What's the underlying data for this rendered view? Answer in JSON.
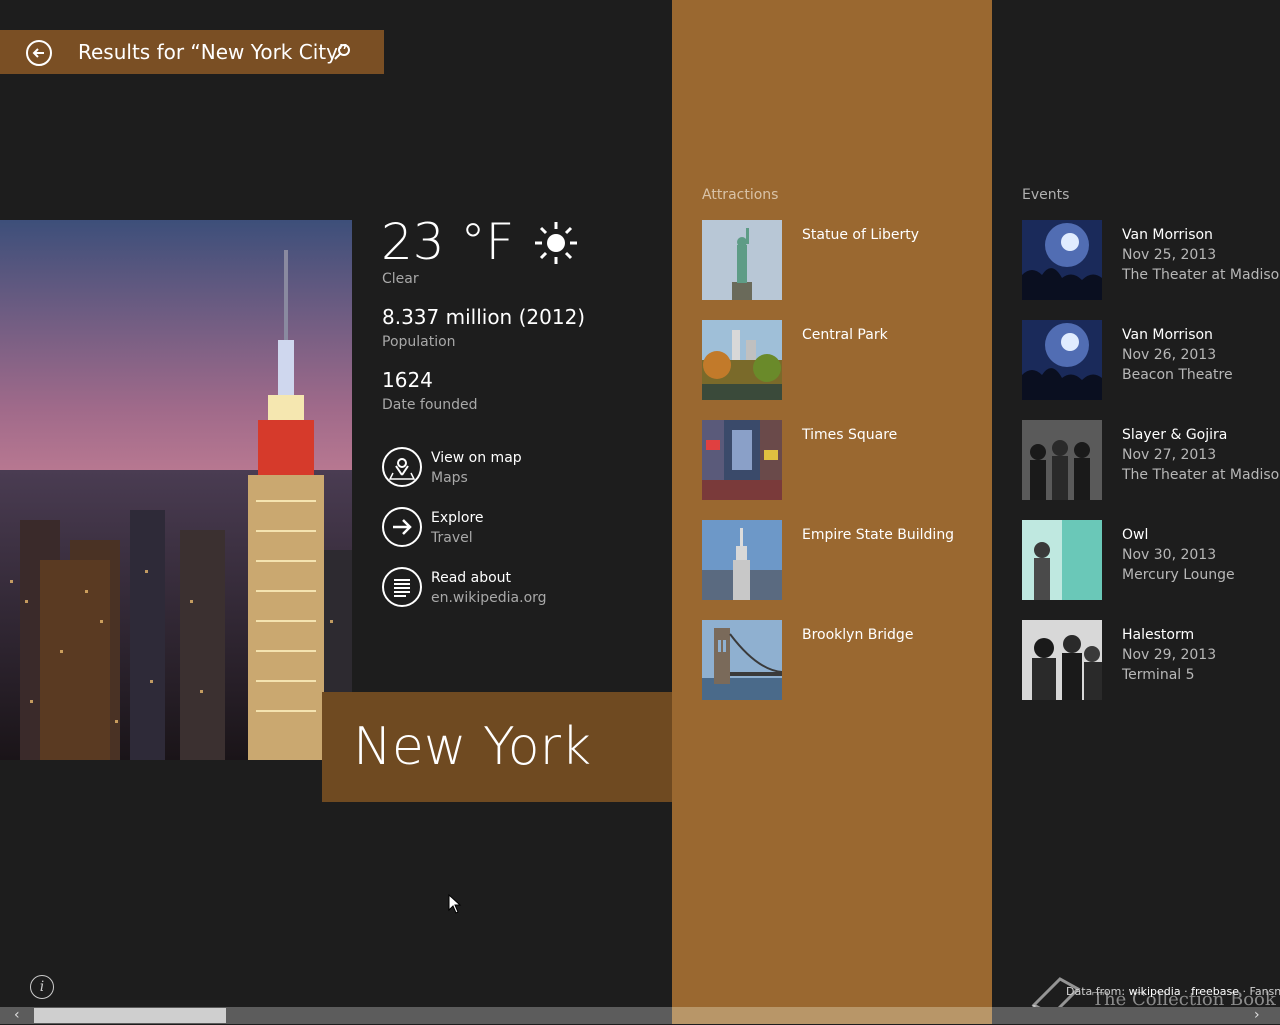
{
  "search": {
    "title": "Results for “New York City”"
  },
  "hero": {
    "city_name": "New York"
  },
  "facts": {
    "temperature": "23 °F",
    "condition": "Clear",
    "weather_icon": "sun-icon",
    "population_value": "8.337 million (2012)",
    "population_label": "Population",
    "founded_value": "1624",
    "founded_label": "Date founded"
  },
  "actions": [
    {
      "title": "View on map",
      "subtitle": "Maps",
      "icon": "map-pin-icon"
    },
    {
      "title": "Explore",
      "subtitle": "Travel",
      "icon": "arrow-right-icon"
    },
    {
      "title": "Read about",
      "subtitle": "en.wikipedia.org",
      "icon": "document-icon"
    }
  ],
  "attractions": {
    "header": "Attractions",
    "items": [
      {
        "name": "Statue of Liberty"
      },
      {
        "name": "Central Park"
      },
      {
        "name": "Times Square"
      },
      {
        "name": "Empire State Building"
      },
      {
        "name": "Brooklyn Bridge"
      }
    ]
  },
  "events": {
    "header": "Events",
    "items": [
      {
        "artist": "Van Morrison",
        "date": "Nov 25, 2013",
        "venue": "The Theater at Madison..."
      },
      {
        "artist": "Van Morrison",
        "date": "Nov 26, 2013",
        "venue": "Beacon Theatre"
      },
      {
        "artist": "Slayer & Gojira",
        "date": "Nov 27, 2013",
        "venue": "The Theater at Madison..."
      },
      {
        "artist": "Owl",
        "date": "Nov 30, 2013",
        "venue": "Mercury Lounge"
      },
      {
        "artist": "Halestorm",
        "date": "Nov 29, 2013",
        "venue": "Terminal 5"
      }
    ]
  },
  "footer": {
    "data_from": "Data from:",
    "source1": "wikipedia",
    "separator": "·",
    "source2": "freebase",
    "source3": "Fansnap",
    "watermark": "The Collection Book"
  },
  "colors": {
    "accent": "#9a6830",
    "title_box": "#6f4a21",
    "search_bar": "#7a4f24",
    "background": "#1d1d1d"
  }
}
